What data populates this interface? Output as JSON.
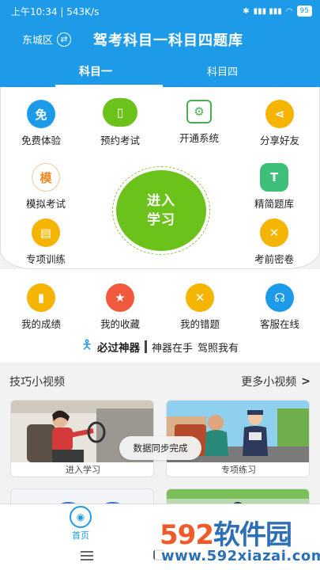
{
  "statusbar": {
    "time_speed": "上午10:34 | 543K/s",
    "signal": "▮▮▮ ▮▮▮",
    "wifi": "◠",
    "battery": "95"
  },
  "header": {
    "district": "东城区",
    "swap_glyph": "⇄",
    "title": "驾考科目一科目四题库"
  },
  "tabs": [
    {
      "label": "科目一"
    },
    {
      "label": "科目四"
    }
  ],
  "features": {
    "free_trial": {
      "label": "免费体验",
      "glyph": "免",
      "color": "#1e9be8"
    },
    "book_exam": {
      "label": "预约考试",
      "glyph": "▯",
      "color": "#6ac21b"
    },
    "activate": {
      "label": "开通系统",
      "glyph": "⚙",
      "color": "#4caf50"
    },
    "share": {
      "label": "分享好友",
      "glyph": "⋖",
      "color": "#f5b400"
    },
    "mock_exam": {
      "label": "模拟考试",
      "glyph": "模",
      "color": "#f08a24"
    },
    "question_bank": {
      "label": "精简题库",
      "glyph": "T",
      "color": "#3dbf7a"
    },
    "special_training": {
      "label": "专项训练",
      "glyph": "▤",
      "color": "#f5b400"
    },
    "pre_exam_secret": {
      "label": "考前密卷",
      "glyph": "✕",
      "color": "#f5b400"
    },
    "my_scores": {
      "label": "我的成绩",
      "glyph": "▮",
      "color": "#f5b400"
    },
    "my_favorites": {
      "label": "我的收藏",
      "glyph": "★",
      "color": "#f05a3c"
    },
    "my_mistakes": {
      "label": "我的错题",
      "glyph": "✕",
      "color": "#f5b400"
    },
    "support": {
      "label": "客服在线",
      "glyph": "☊",
      "color": "#1e9be8"
    }
  },
  "enter_study": {
    "line1": "进入",
    "line2": "学习"
  },
  "slogan": {
    "main": "必过神器",
    "sub1": "神器在手",
    "sub2": "驾照我有"
  },
  "videos": {
    "section_title": "技巧小视频",
    "more_label": "更多小视频",
    "more_chevron": ">",
    "cards": [
      {
        "caption": "进入学习"
      },
      {
        "caption": "专项练习"
      }
    ]
  },
  "toast": "数据同步完成",
  "bottom_nav": {
    "home": "首页"
  },
  "watermark": {
    "brand_num": "592",
    "brand_text": "软件园",
    "url": "www.592xiazai.com"
  }
}
